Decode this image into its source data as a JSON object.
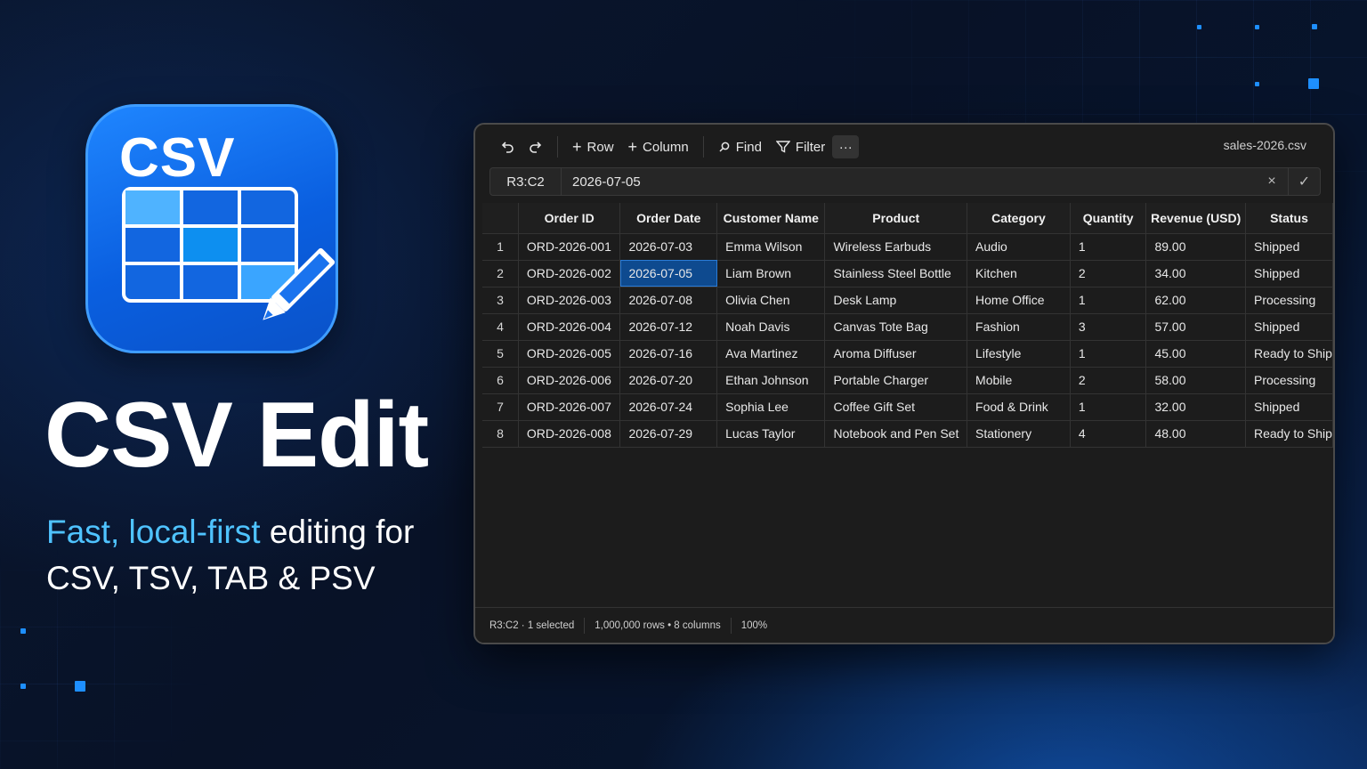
{
  "brand": {
    "icon_text": "CSV",
    "title": "CSV Edit",
    "tagline_hl": "Fast, local-first",
    "tagline_rest": " editing for",
    "tagline_line2": "CSV, TSV, TAB & PSV"
  },
  "colors": {
    "accent": "#1e8fff",
    "highlight_text": "#4fc3ff",
    "selected_cell": "#0e4a8f"
  },
  "toolbar": {
    "undo_icon": "undo-icon",
    "redo_icon": "redo-icon",
    "row_label": "Row",
    "column_label": "Column",
    "find_label": "Find",
    "filter_label": "Filter",
    "more_label": "···",
    "file_name": "sales-2026.csv"
  },
  "formula_bar": {
    "cell_ref": "R3:C2",
    "value": "2026-07-05",
    "clear_icon": "×",
    "confirm_icon": "✓"
  },
  "table": {
    "headers": [
      "",
      "Order ID",
      "Order Date",
      "Customer Name",
      "Product",
      "Category",
      "Quantity",
      "Revenue (USD)",
      "Status"
    ],
    "rows": [
      [
        "1",
        "ORD-2026-001",
        "2026-07-03",
        "Emma Wilson",
        "Wireless Earbuds",
        "Audio",
        "1",
        "89.00",
        "Shipped"
      ],
      [
        "2",
        "ORD-2026-002",
        "2026-07-05",
        "Liam Brown",
        "Stainless Steel Bottle",
        "Kitchen",
        "2",
        "34.00",
        "Shipped"
      ],
      [
        "3",
        "ORD-2026-003",
        "2026-07-08",
        "Olivia Chen",
        "Desk Lamp",
        "Home Office",
        "1",
        "62.00",
        "Processing"
      ],
      [
        "4",
        "ORD-2026-004",
        "2026-07-12",
        "Noah Davis",
        "Canvas Tote Bag",
        "Fashion",
        "3",
        "57.00",
        "Shipped"
      ],
      [
        "5",
        "ORD-2026-005",
        "2026-07-16",
        "Ava Martinez",
        "Aroma Diffuser",
        "Lifestyle",
        "1",
        "45.00",
        "Ready to Ship"
      ],
      [
        "6",
        "ORD-2026-006",
        "2026-07-20",
        "Ethan Johnson",
        "Portable Charger",
        "Mobile",
        "2",
        "58.00",
        "Processing"
      ],
      [
        "7",
        "ORD-2026-007",
        "2026-07-24",
        "Sophia Lee",
        "Coffee Gift Set",
        "Food & Drink",
        "1",
        "32.00",
        "Shipped"
      ],
      [
        "8",
        "ORD-2026-008",
        "2026-07-29",
        "Lucas Taylor",
        "Notebook and Pen Set",
        "Stationery",
        "4",
        "48.00",
        "Ready to Ship"
      ]
    ],
    "selected": {
      "row": 1,
      "col": 2
    }
  },
  "status_bar": {
    "selection": "R3:C2 · 1 selected",
    "dimensions": "1,000,000 rows • 8 columns",
    "zoom": "100%"
  }
}
